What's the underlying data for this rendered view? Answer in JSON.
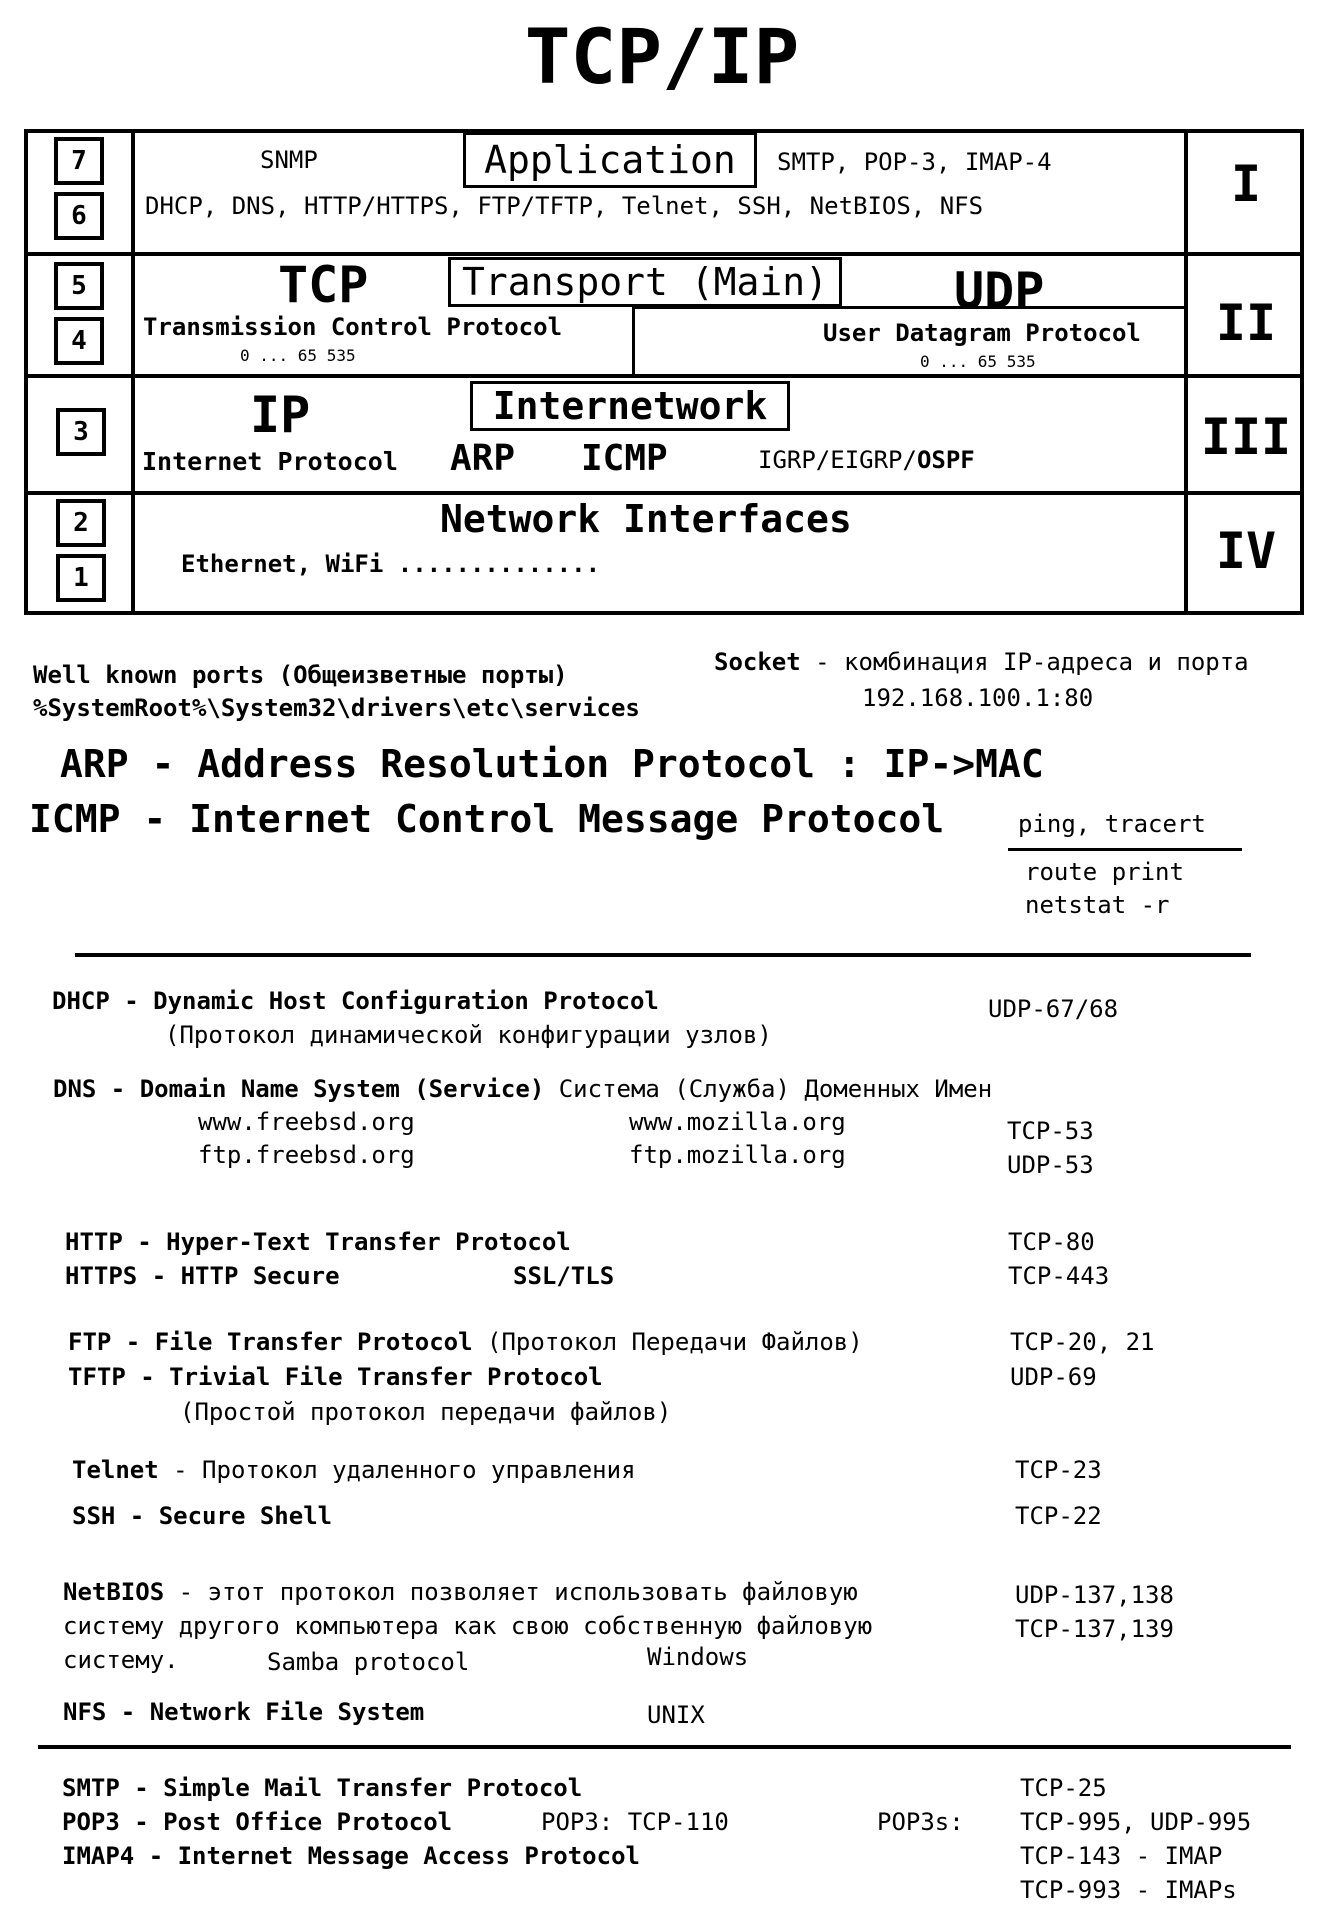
{
  "title": "TCP/IP",
  "layers": {
    "app": {
      "osi": [
        "7",
        "6"
      ],
      "roman": "I",
      "name": "Application",
      "snmp": "SNMP",
      "mail": "SMTP, POP-3, IMAP-4",
      "protocols": "DHCP, DNS, HTTP/HTTPS, FTP/TFTP, Telnet, SSH, NetBIOS, NFS"
    },
    "transport": {
      "osi": [
        "5",
        "4"
      ],
      "roman": "II",
      "name": "Transport (Main)",
      "tcp": "TCP",
      "tcp_full": "Transmission Control Protocol",
      "tcp_range": "0 ... 65 535",
      "udp": "UDP",
      "udp_full": "User Datagram Protocol",
      "udp_range": "0 ... 65 535"
    },
    "internet": {
      "osi": [
        "3"
      ],
      "roman": "III",
      "name": "Internetwork",
      "ip": "IP",
      "ip_full": "Internet Protocol",
      "arp": "ARP",
      "icmp": "ICMP",
      "routing_prefix": "IGRP/EIGRP/",
      "routing_bold": "OSPF"
    },
    "network": {
      "osi": [
        "2",
        "1"
      ],
      "roman": "IV",
      "name": "Network Interfaces",
      "examples": "Ethernet, WiFi .............."
    }
  },
  "ports": {
    "wellknown_bold": "Well known ports",
    "wellknown_rest": " (Общеизветные порты)",
    "path": "%SystemRoot%\\System32\\drivers\\etc\\services"
  },
  "socket": {
    "term": "Socket",
    "desc": " - комбинация IP-адреса и порта",
    "example": "192.168.100.1:80"
  },
  "arp_def": "ARP - Address Resolution Protocol  : IP->MAC",
  "icmp_def": "ICMP - Internet Control Message Protocol",
  "commands": {
    "ping": "ping, tracert",
    "route": "route print",
    "netstat": "netstat -r"
  },
  "protocols": {
    "dhcp": {
      "name": "DHCP - Dynamic Host Configuration Protocol",
      "ru": "(Протокол динамической конфигурации узлов)",
      "port": "UDP-67/68"
    },
    "dns": {
      "name": "DNS - Domain Name System (Service)",
      "ru": " Система (Служба) Доменных Имен",
      "ex1": "www.freebsd.org",
      "ex2": "ftp.freebsd.org",
      "ex3": "www.mozilla.org",
      "ex4": "ftp.mozilla.org",
      "port1": "TCP-53",
      "port2": "UDP-53"
    },
    "http": {
      "name": "HTTP  - Hyper-Text Transfer Protocol",
      "port": "TCP-80"
    },
    "https": {
      "name": "HTTPS - HTTP Secure",
      "ssl": "SSL/TLS",
      "port": "TCP-443"
    },
    "ftp": {
      "name": "FTP  - File Transfer Protocol",
      "ru": " (Протокол Передачи Файлов)",
      "port": "TCP-20, 21"
    },
    "tftp": {
      "name": "TFTP - Trivial File Transfer Protocol",
      "ru": "(Простой протокол передачи файлов)",
      "port": "UDP-69"
    },
    "telnet": {
      "name": "Telnet",
      "ru": " - Протокол удаленного управления",
      "port": "TCP-23"
    },
    "ssh": {
      "name": "SSH - Secure Shell",
      "port": "TCP-22"
    },
    "netbios": {
      "name": "NetBIOS",
      "line1": " - этот протокол позволяет использовать файловую",
      "line2": "систему другого компьютера как свою собственную файловую",
      "line3": "систему.",
      "samba": "Samba protocol",
      "os": "Windows",
      "port1": "UDP-137,138",
      "port2": "TCP-137,139"
    },
    "nfs": {
      "name": "NFS - Network File System",
      "os": "UNIX"
    },
    "smtp": {
      "name": "SMTP  - Simple Mail Transfer Protocol",
      "port": "TCP-25"
    },
    "pop3": {
      "name": "POP3  - Post Office Protocol",
      "extra": "POP3: TCP-110",
      "secure": "POP3s:",
      "port": "TCP-995, UDP-995"
    },
    "imap4": {
      "name": "IMAP4 - Internet Message Access Protocol",
      "port1": "TCP-143 - IMAP",
      "port2": "TCP-993 - IMAPs"
    }
  }
}
